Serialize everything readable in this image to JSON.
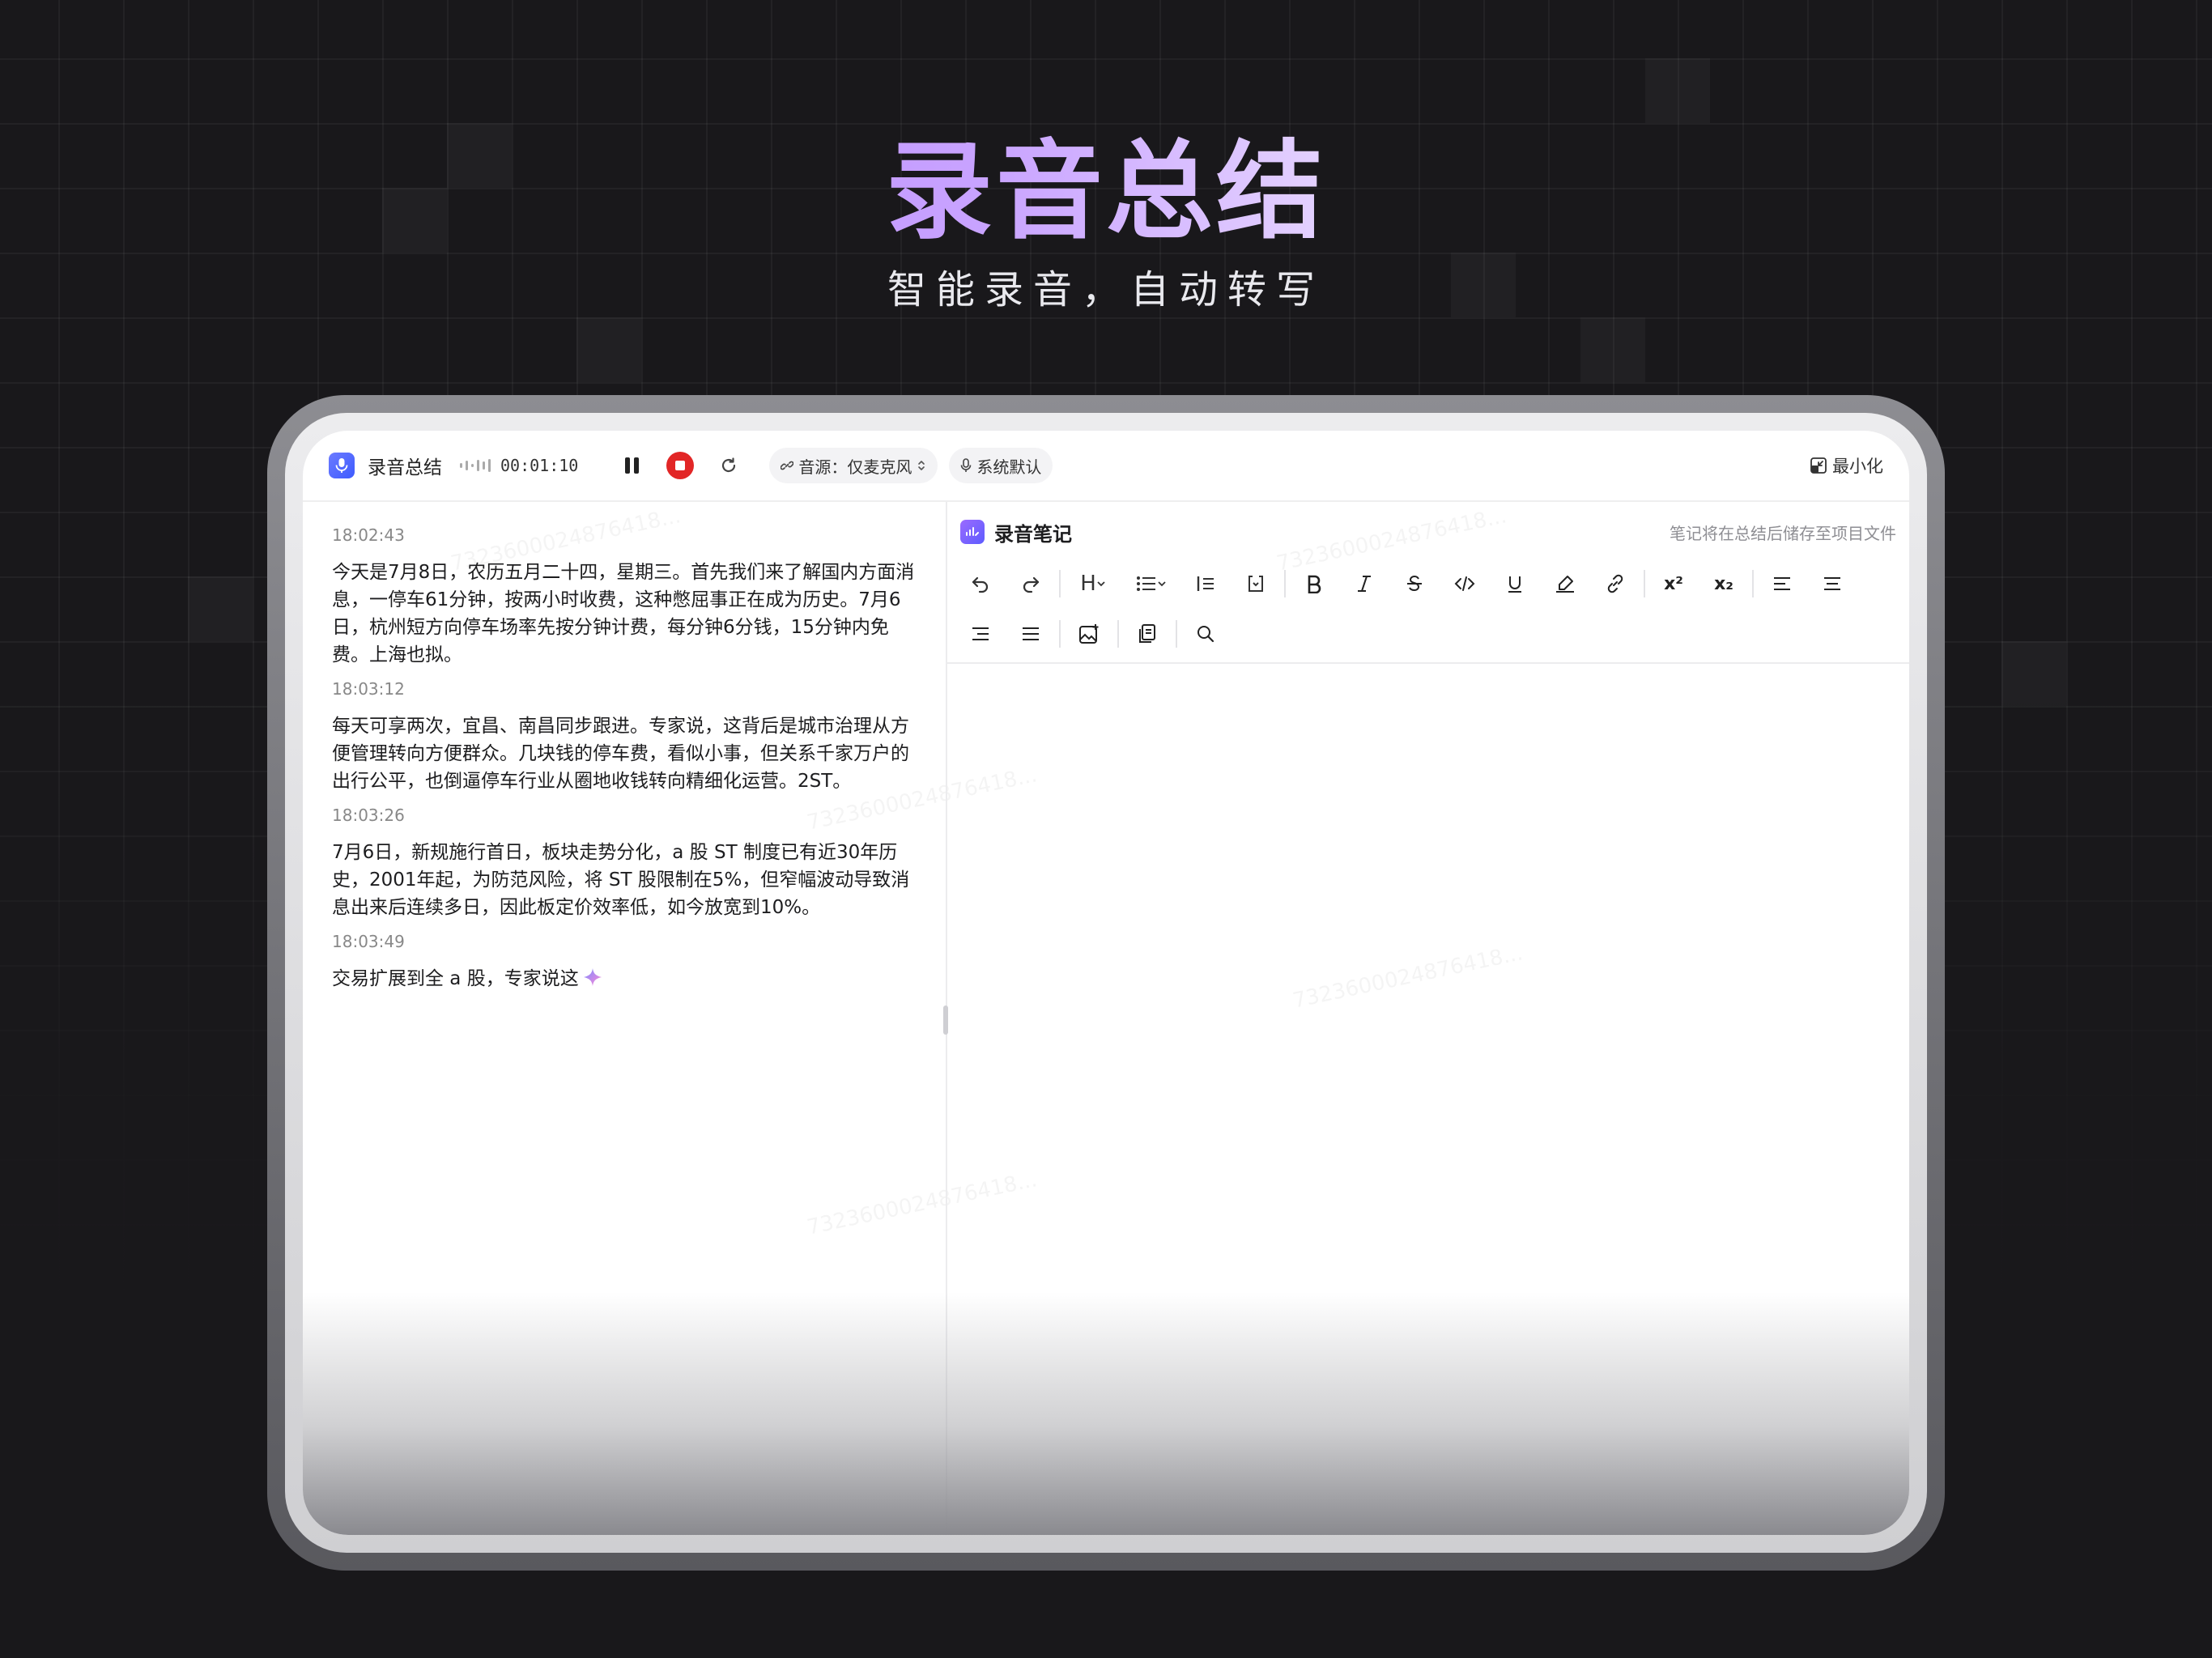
{
  "hero": {
    "title": "录音总结",
    "subtitle": "智能录音，自动转写"
  },
  "topbar": {
    "app_title": "录音总结",
    "timer": "00:01:10",
    "source_label": "音源：仅麦克风",
    "mic_label": "系统默认",
    "minimize_label": "最小化"
  },
  "transcript": [
    {
      "time": "18:02:43",
      "text": "今天是7月8日，农历五月二十四，星期三。首先我们来了解国内方面消息，一停车61分钟，按两小时收费，这种憋屈事正在成为历史。7月6日，杭州短方向停车场率先按分钟计费，每分钟6分钱，15分钟内免费。上海也拟。"
    },
    {
      "time": "18:03:12",
      "text": "每天可享两次，宜昌、南昌同步跟进。专家说，这背后是城市治理从方便管理转向方便群众。几块钱的停车费，看似小事，但关系千家万户的出行公平，也倒逼停车行业从圈地收钱转向精细化运营。2ST。"
    },
    {
      "time": "18:03:26",
      "text": "7月6日，新规施行首日，板块走势分化，a 股 ST 制度已有近30年历史，2001年起，为防范风险，将 ST 股限制在5%，但窄幅波动导致消息出来后连续多日，因此板定价效率低，如今放宽到10%。"
    },
    {
      "time": "18:03:49",
      "text": "交易扩展到全 a 股，专家说这"
    }
  ],
  "notes": {
    "title": "录音笔记",
    "hint": "笔记将在总结后储存至项目文件"
  },
  "toolbar": {
    "heading_label": "H",
    "superscript_label": "x²",
    "subscript_label": "x₂"
  },
  "colors": {
    "background": "#19181b",
    "accent_purple": "#a66cff",
    "record_red": "#e22626",
    "app_icon_blue": "#3d5bff"
  }
}
